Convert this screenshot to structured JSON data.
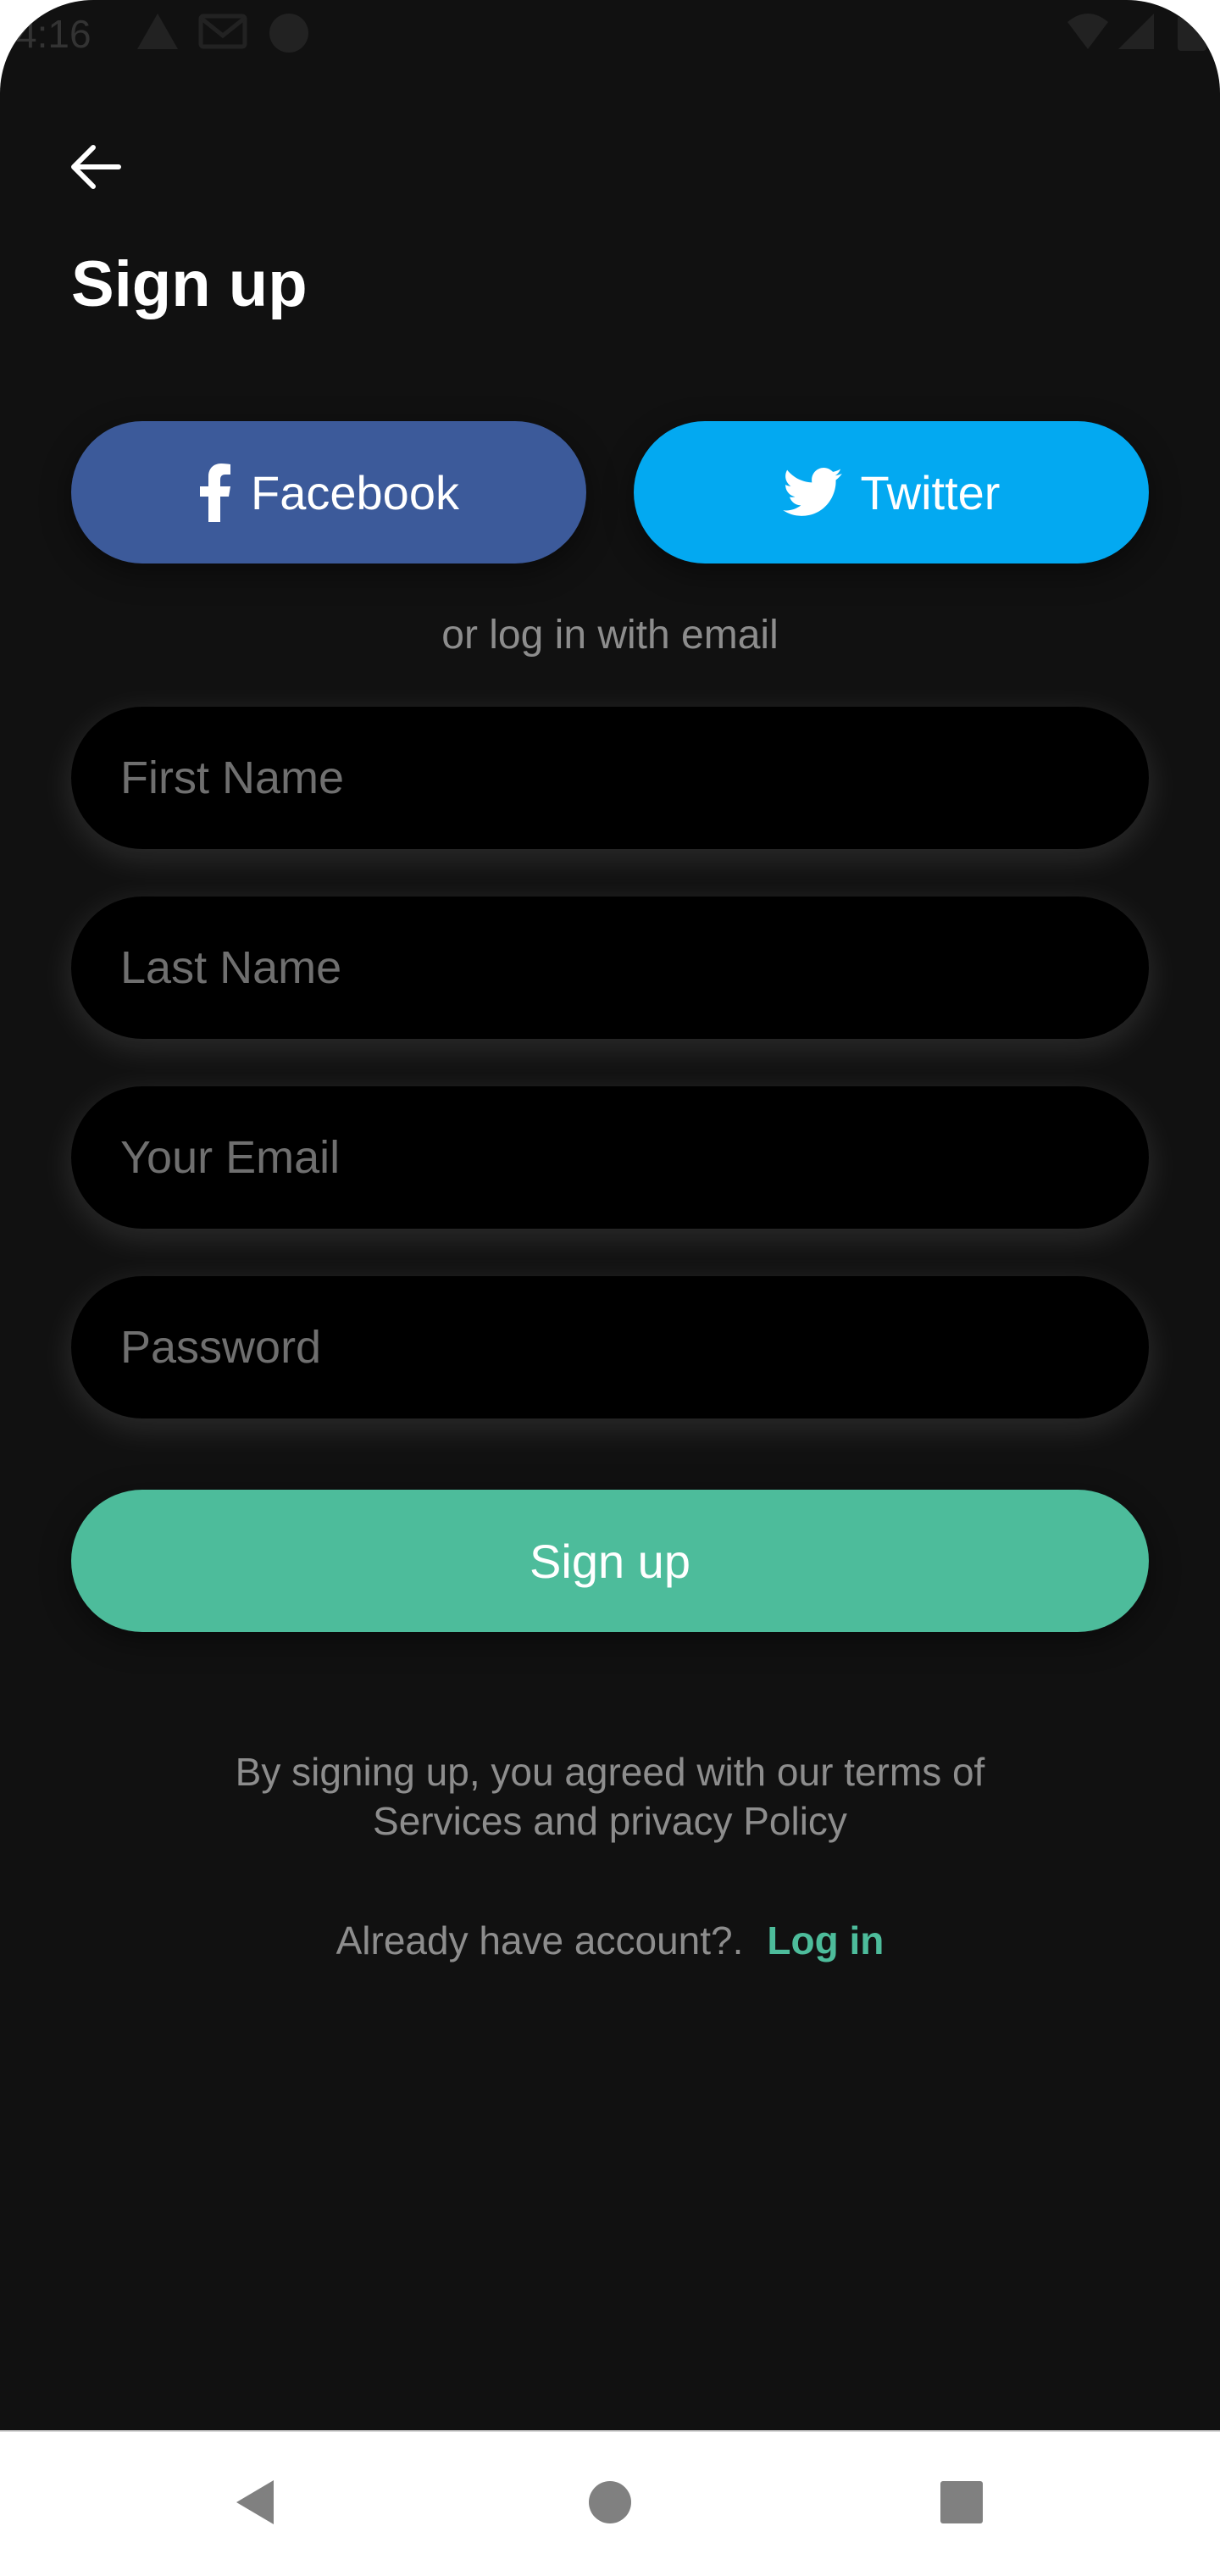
{
  "status_bar": {
    "time": "4:16",
    "icons": [
      "warning-icon",
      "gmail-icon",
      "notification-icon",
      "wifi-icon",
      "signal-icon",
      "battery-icon"
    ]
  },
  "header": {
    "back_icon": "arrow-left-icon",
    "title": "Sign up"
  },
  "social": {
    "facebook_label": "Facebook",
    "facebook_icon": "facebook-icon",
    "twitter_label": "Twitter",
    "twitter_icon": "twitter-icon"
  },
  "divider_text": "or log in with email",
  "form": {
    "first_name_placeholder": "First Name",
    "last_name_placeholder": "Last Name",
    "email_placeholder": "Your Email",
    "password_placeholder": "Password",
    "submit_label": "Sign up"
  },
  "terms": {
    "line1": "By signing up, you agreed with our terms of",
    "line2": "Services and privacy Policy"
  },
  "login": {
    "question": "Already have account?.",
    "link": "Log in"
  },
  "nav": {
    "icons": [
      "nav-back-icon",
      "nav-home-icon",
      "nav-recents-icon"
    ]
  },
  "colors": {
    "background": "#111111",
    "facebook": "#3c5a9a",
    "twitter": "#03a9f1",
    "accent": "#4dbc9b",
    "muted_text": "#8d8d8d",
    "input_bg": "#000000"
  }
}
